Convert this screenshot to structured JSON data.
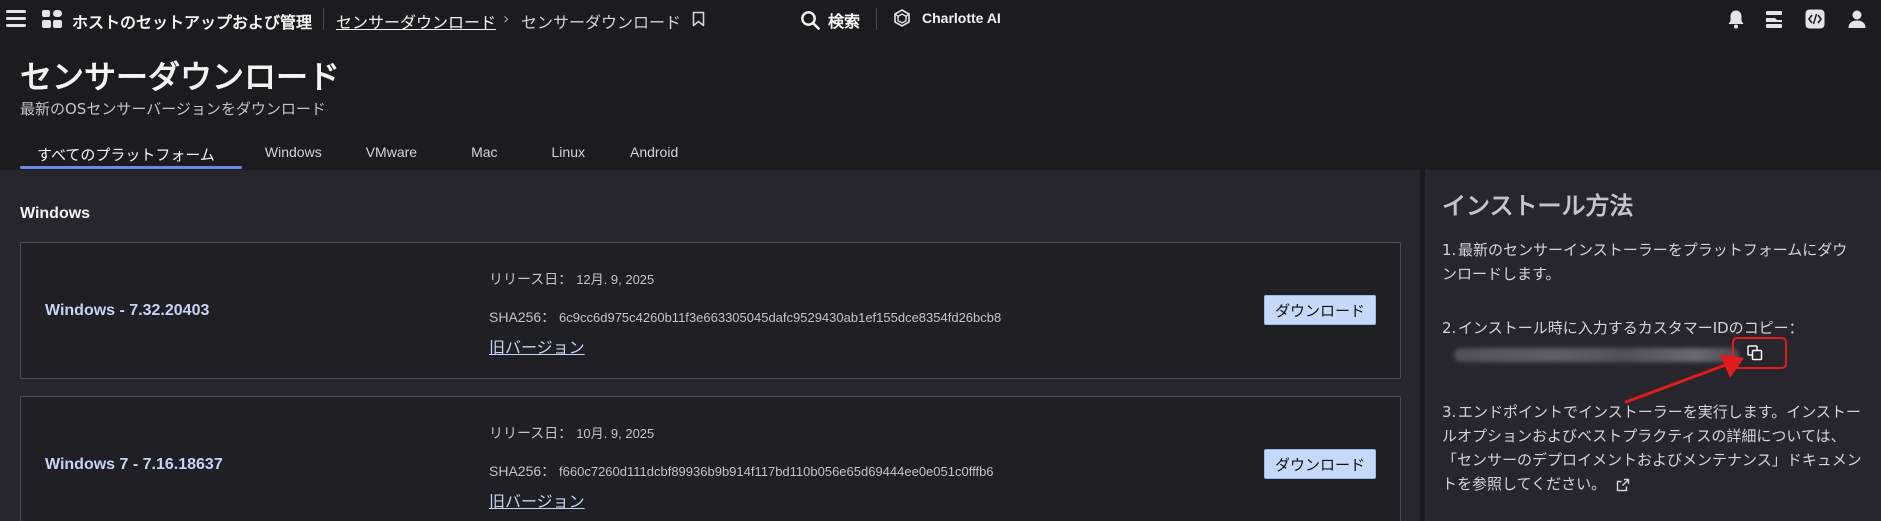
{
  "topbar": {
    "app_title": "ホストのセットアップおよび管理",
    "breadcrumb_link": "センサーダウンロード",
    "breadcrumb_chevron": "›",
    "breadcrumb_current": "センサーダウンロード",
    "search_label": "検索",
    "charlotte_label": "Charlotte AI"
  },
  "header": {
    "title": "センサーダウンロード",
    "subtitle": "最新のOSセンサーバージョンをダウンロード"
  },
  "tabs": [
    {
      "label": "すべてのプラットフォーム",
      "active": true
    },
    {
      "label": "Windows",
      "active": false
    },
    {
      "label": "VMware",
      "active": false
    },
    {
      "label": "Mac",
      "active": false
    },
    {
      "label": "Linux",
      "active": false
    },
    {
      "label": "Android",
      "active": false
    }
  ],
  "main": {
    "section_title": "Windows",
    "cards": [
      {
        "name": "Windows - 7.32.20403",
        "release_label": "リリース日：",
        "release_date": "12月. 9, 2025",
        "sha_label": "SHA256：",
        "sha": "6c9cc6d975c4260b11f3e663305045dafc9529430ab1ef155dce8354fd26bcb8",
        "old_versions": "旧バージョン",
        "download": "ダウンロード"
      },
      {
        "name": "Windows 7 - 7.16.18637",
        "release_label": "リリース日：",
        "release_date": "10月. 9, 2025",
        "sha_label": "SHA256：",
        "sha": "f660c7260d111dcbf89936b9b914f117bd110b056e65d69444ee0e051c0fffb6",
        "old_versions": "旧バージョン",
        "download": "ダウンロード"
      }
    ]
  },
  "side": {
    "title": "インストール方法",
    "steps": [
      {
        "num": "1.",
        "text": "最新のセンサーインストーラーをプラットフォームにダウンロードします。"
      },
      {
        "num": "2.",
        "text": "インストール時に入力するカスタマーIDのコピー："
      },
      {
        "num": "3.",
        "text": "エンドポイントでインストーラーを実行します。インストールオプションおよびベストプラクティスの詳細については、「センサーのデプロイメントおよびメンテナンス」ドキュメントを参照してください。"
      }
    ]
  },
  "colors": {
    "background": "#1c1c1e",
    "panel": "#26262c",
    "accent": "#6b8ae8",
    "button": "#c7d9fb",
    "highlight": "#e01b1b"
  }
}
